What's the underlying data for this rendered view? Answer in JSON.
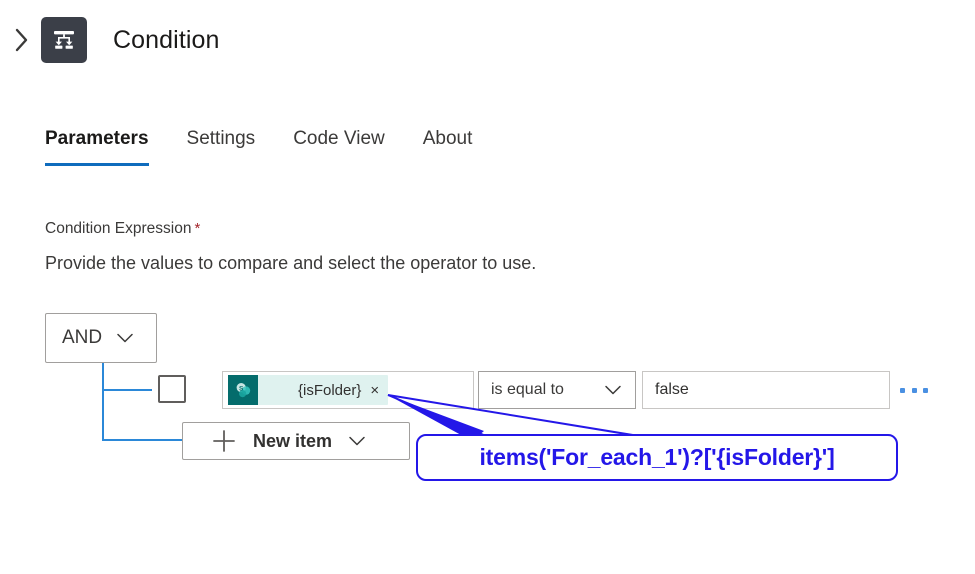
{
  "header": {
    "collapse_icon": "chevron-right-icon",
    "node_icon": "condition-branch-icon",
    "title": "Condition"
  },
  "tabs": [
    {
      "label": "Parameters",
      "active": true
    },
    {
      "label": "Settings",
      "active": false
    },
    {
      "label": "Code View",
      "active": false
    },
    {
      "label": "About",
      "active": false
    }
  ],
  "form": {
    "field_label": "Condition Expression",
    "required_marker": "*",
    "description": "Provide the values to compare and select the operator to use."
  },
  "condition_builder": {
    "group_operator": {
      "label": "AND",
      "chevron_icon": "chevron-down-icon"
    },
    "row": {
      "checkbox_checked": false,
      "operand_token": {
        "icon": "sharepoint-icon",
        "label": "{isFolder}",
        "remove_label": "×"
      },
      "operator": {
        "label": "is equal to",
        "chevron_icon": "chevron-down-icon"
      },
      "value": "false",
      "overflow_icon": "ellipsis-icon"
    },
    "new_item": {
      "plus_icon": "plus-icon",
      "label": "New item",
      "chevron_icon": "chevron-down-icon"
    }
  },
  "annotation": {
    "expression": "items('For_each_1')?['{isFolder}']",
    "arrow_icon": "callout-arrow-icon"
  },
  "colors": {
    "accent": "#0f6cbd",
    "connector": "#2b88d8",
    "annotation": "#2417e8",
    "required": "#a4262c",
    "node_icon_bg": "#3b3f48",
    "token_bg": "#dff2ef",
    "sharepoint": "#046c6c"
  }
}
